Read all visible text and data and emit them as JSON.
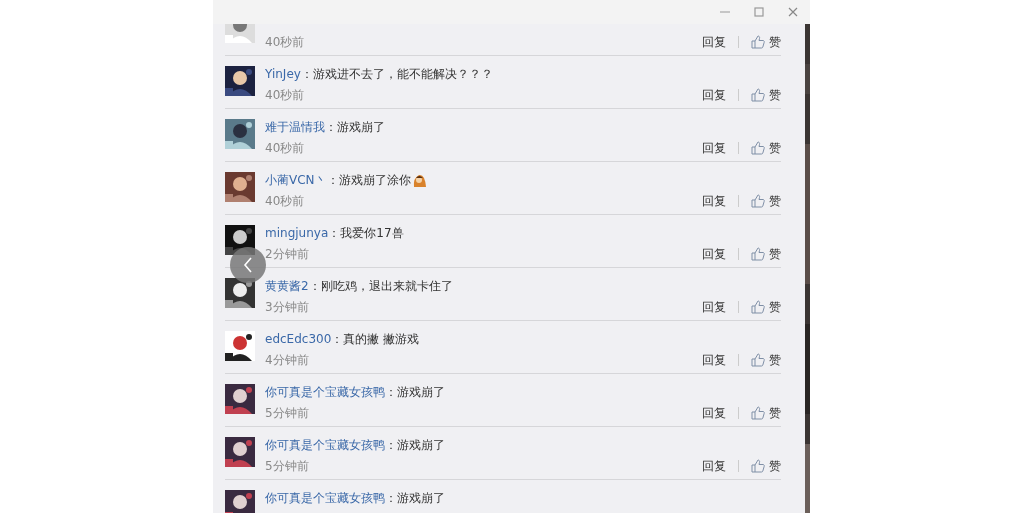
{
  "comments": [
    {
      "time": "40秒前",
      "reply": "回复",
      "like": "赞"
    },
    {
      "user": "YinJey",
      "text": "：游戏进不去了，能不能解决？？？",
      "time": "40秒前",
      "reply": "回复",
      "like": "赞"
    },
    {
      "user": "难于温情我",
      "text": "：游戏崩了",
      "time": "40秒前",
      "reply": "回复",
      "like": "赞"
    },
    {
      "user": "小蔺VCN丶 ",
      "text": "：游戏崩了涂你",
      "sticker": true,
      "time": "40秒前",
      "reply": "回复",
      "like": "赞"
    },
    {
      "user": "mingjunya",
      "text": "：我爱你17兽",
      "time": "2分钟前",
      "reply": "回复",
      "like": "赞"
    },
    {
      "user": "黄黄酱2",
      "text": "：刚吃鸡，退出来就卡住了",
      "time": "3分钟前",
      "reply": "回复",
      "like": "赞"
    },
    {
      "user": "edcEdc300",
      "text": "：真的撇 撇游戏",
      "time": "4分钟前",
      "reply": "回复",
      "like": "赞"
    },
    {
      "user": "你可真是个宝藏女孩鸭",
      "text": "：游戏崩了",
      "time": "5分钟前",
      "reply": "回复",
      "like": "赞"
    },
    {
      "user": "你可真是个宝藏女孩鸭",
      "text": "：游戏崩了",
      "time": "5分钟前",
      "reply": "回复",
      "like": "赞"
    },
    {
      "user": "你可真是个宝藏女孩鸭",
      "text": "：游戏崩了"
    }
  ]
}
